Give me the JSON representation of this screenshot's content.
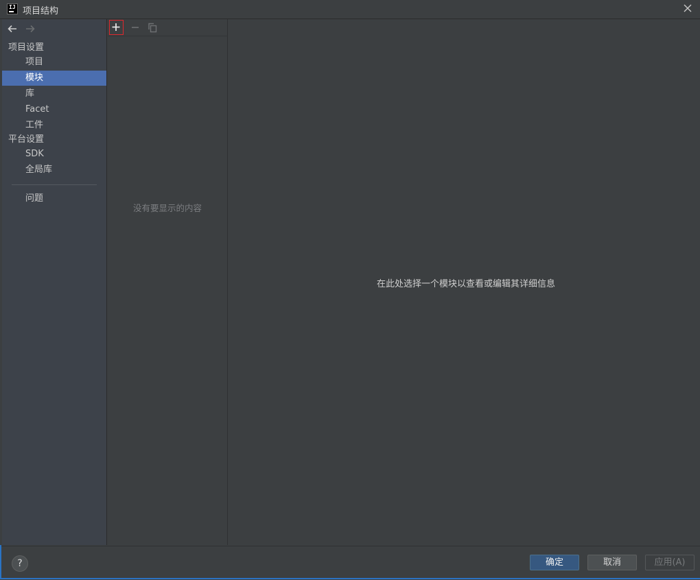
{
  "window": {
    "title": "项目结构",
    "logo_text": "IJ"
  },
  "sidebar": {
    "project_settings_header": "项目设置",
    "project_settings_items": [
      "项目",
      "模块",
      "库",
      "Facet",
      "工件"
    ],
    "platform_settings_header": "平台设置",
    "platform_settings_items": [
      "SDK",
      "全局库"
    ],
    "problems_label": "问题",
    "selected_item": "模块"
  },
  "module_list": {
    "empty_text": "没有要显示的内容"
  },
  "detail": {
    "hint": "在此处选择一个模块以查看或编辑其详细信息"
  },
  "buttons": {
    "help": "?",
    "ok": "确定",
    "cancel": "取消",
    "apply": "应用(A)"
  },
  "colors": {
    "accent_selection": "#4b6eaf",
    "highlight_box": "#e0272d",
    "primary_button": "#365880"
  }
}
